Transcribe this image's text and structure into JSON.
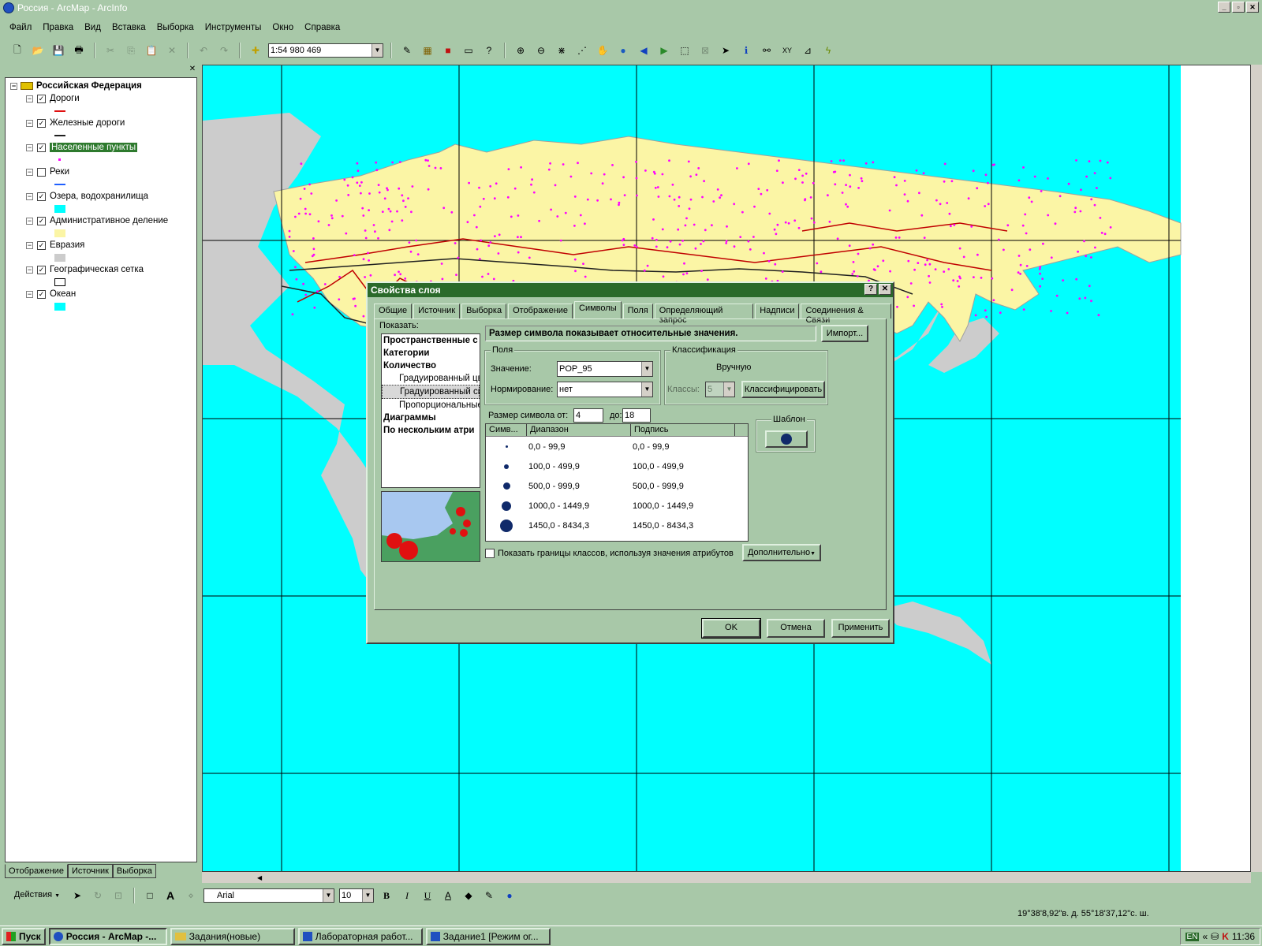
{
  "window": {
    "title": "Россия - ArcMap - ArcInfo"
  },
  "menu": [
    "Файл",
    "Правка",
    "Вид",
    "Вставка",
    "Выборка",
    "Инструменты",
    "Окно",
    "Справка"
  ],
  "toolbar": {
    "scale": "1:54 980 469"
  },
  "toc": {
    "root": "Российская Федерация",
    "layers": [
      {
        "name": "Дороги",
        "checked": "✓",
        "swatch": "line",
        "color": "#e01010"
      },
      {
        "name": "Железные дороги",
        "checked": "✓",
        "swatch": "line",
        "color": "#202020"
      },
      {
        "name": "Населенные пункты",
        "checked": "✓",
        "swatch": "dot",
        "color": "#ff00ff"
      },
      {
        "name": "Реки",
        "checked": "",
        "swatch": "line",
        "color": "#2060ff"
      },
      {
        "name": "Озера, водохранилища",
        "checked": "✓",
        "swatch": "fill",
        "color": "#00ffff"
      },
      {
        "name": "Административное деление",
        "checked": "✓",
        "swatch": "fill",
        "color": "#fbf5a5"
      },
      {
        "name": "Евразия",
        "checked": "✓",
        "swatch": "fill",
        "color": "#cccccc"
      },
      {
        "name": "Географическая сетка",
        "checked": "✓",
        "swatch": "outline",
        "color": "#000000"
      },
      {
        "name": "Океан",
        "checked": "✓",
        "swatch": "fill",
        "color": "#00ffff"
      }
    ],
    "tabs": [
      "Отображение",
      "Источник",
      "Выборка"
    ]
  },
  "dialog": {
    "title": "Свойства слоя",
    "tabs": [
      "Общие",
      "Источник",
      "Выборка",
      "Отображение",
      "Символы",
      "Поля",
      "Определяющий запрос",
      "Надписи",
      "Соединения & Связи"
    ],
    "show_label": "Показать:",
    "show_items": [
      {
        "text": "Пространственные с",
        "style": "b"
      },
      {
        "text": "Категории",
        "style": "b"
      },
      {
        "text": "Количество",
        "style": "b"
      },
      {
        "text": "Градуированный цве",
        "style": "sub"
      },
      {
        "text": "Градуированный сим",
        "style": "sub hl"
      },
      {
        "text": "Пропорциональные",
        "style": "sub"
      },
      {
        "text": "Диаграммы",
        "style": "b"
      },
      {
        "text": "По нескольким атри",
        "style": "b"
      }
    ],
    "description": "Размер символа показывает относительные значения.",
    "import_button": "Импорт...",
    "fields_group": "Поля",
    "value_label": "Значение:",
    "value": "POP_95",
    "normalization_label": "Нормирование:",
    "normalization": "нет",
    "classification_group": "Классификация",
    "classification_method": "Вручную",
    "classes_label": "Классы:",
    "classes": "5",
    "classify_button": "Классифицировать",
    "size_from_label": "Размер символа от:",
    "size_from": "4",
    "size_to_label": "до:",
    "size_to": "18",
    "template_label": "Шаблон",
    "table_headers": [
      "Симв...",
      "Диапазон",
      "Подпись"
    ],
    "rows": [
      {
        "range": "0,0 - 99,9",
        "label": "0,0 - 99,9",
        "size": 3
      },
      {
        "range": "100,0 - 499,9",
        "label": "100,0 - 499,9",
        "size": 6
      },
      {
        "range": "500,0 - 999,9",
        "label": "500,0 - 999,9",
        "size": 9
      },
      {
        "range": "1000,0 - 1449,9",
        "label": "1000,0 - 1449,9",
        "size": 12
      },
      {
        "range": "1450,0 - 8434,3",
        "label": "1450,0 - 8434,3",
        "size": 16
      }
    ],
    "show_bounds_label": "Показать границы классов, используя значения атрибутов",
    "advanced_button": "Дополнительно",
    "ok": "OK",
    "cancel": "Отмена",
    "apply": "Применить"
  },
  "drawing": {
    "actions": "Действия",
    "font": "Arial",
    "font_size": "10"
  },
  "status": {
    "coords": "19°38'8,92\"в. д.  55°18'37,12\"с. ш."
  },
  "taskbar": {
    "start": "Пуск",
    "tasks": [
      "Россия - ArcMap -...",
      "Задания(новые)",
      "Лабораторная работ...",
      "Задание1 [Режим ог..."
    ],
    "lang": "EN",
    "clock": "11:36"
  },
  "colors": {
    "ocean": "#00ffff",
    "land": "#fbf5a5",
    "other_land": "#cccccc",
    "dialog_title": "#2a6a2a"
  }
}
